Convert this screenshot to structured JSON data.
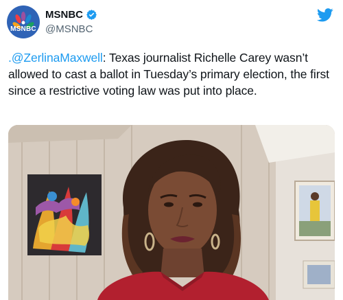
{
  "account": {
    "display_name": "MSNBC",
    "handle": "@MSNBC",
    "avatar_text": "MSNBC",
    "verified": true
  },
  "tweet": {
    "mention": ".@ZerlinaMaxwell",
    "text": ": Texas journalist Richelle Carey wasn’t allowed to cast a ballot in Tuesday’s primary election, the first since a restrictive voting law was put into place."
  },
  "icons": {
    "verified": "verified-badge-icon",
    "platform": "twitter-bird-icon"
  },
  "colors": {
    "brand_blue": "#1d9bf0",
    "avatar_blue": "#2f63b6",
    "text": "#0f1419",
    "secondary_text": "#536471"
  }
}
